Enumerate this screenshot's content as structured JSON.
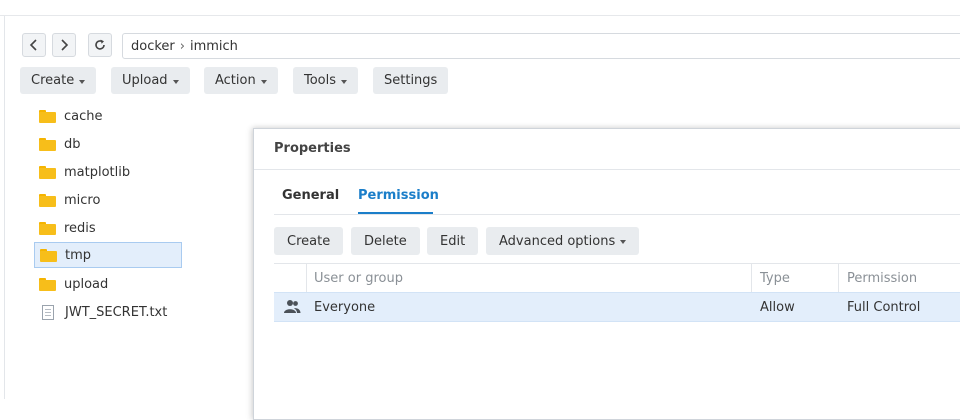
{
  "nav": {
    "back_icon": "chevron-left-icon",
    "forward_icon": "chevron-right-icon",
    "refresh_icon": "refresh-icon"
  },
  "path": {
    "segments": [
      "docker",
      "immich"
    ],
    "separator": "›"
  },
  "toolbar": {
    "create": "Create",
    "upload": "Upload",
    "action": "Action",
    "tools": "Tools",
    "settings": "Settings"
  },
  "files": [
    {
      "name": "cache",
      "type": "folder"
    },
    {
      "name": "db",
      "type": "folder"
    },
    {
      "name": "matplotlib",
      "type": "folder"
    },
    {
      "name": "micro",
      "type": "folder"
    },
    {
      "name": "redis",
      "type": "folder"
    },
    {
      "name": "tmp",
      "type": "folder",
      "selected": true
    },
    {
      "name": "upload",
      "type": "folder"
    },
    {
      "name": "JWT_SECRET.txt",
      "type": "file"
    }
  ],
  "dialog": {
    "title": "Properties",
    "tabs": {
      "general": "General",
      "permission": "Permission",
      "active": "permission"
    },
    "buttons": {
      "create": "Create",
      "delete": "Delete",
      "edit": "Edit",
      "advanced": "Advanced options"
    },
    "table": {
      "headers": {
        "user": "User or group",
        "type": "Type",
        "permission": "Permission"
      },
      "rows": [
        {
          "icon": "group-icon",
          "user": "Everyone",
          "type": "Allow",
          "permission": "Full Control",
          "selected": true
        }
      ]
    }
  },
  "colors": {
    "accent": "#1b7ec9",
    "folder": "#f7be1a",
    "selection": "#e3eefb",
    "button_bg": "#e9ecef"
  }
}
